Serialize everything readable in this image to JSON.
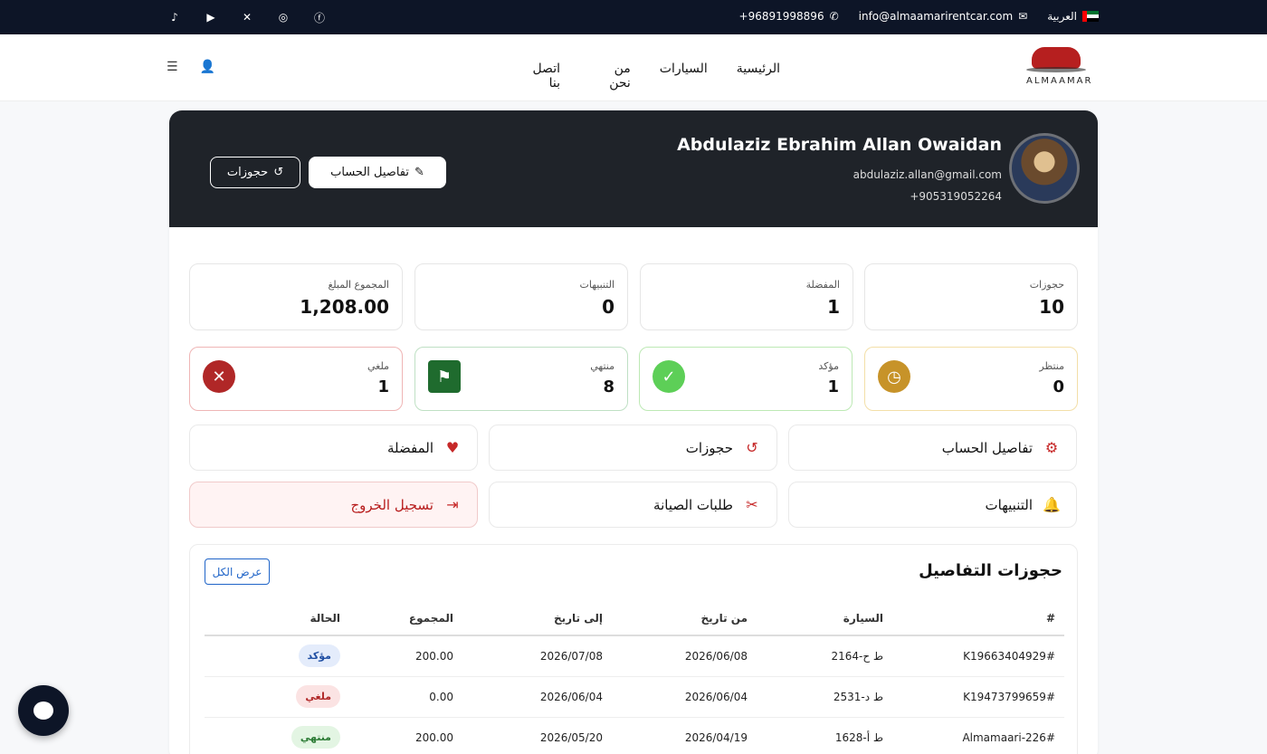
{
  "topbar": {
    "language": "العربية",
    "email": "info@almaamarirentcar.com",
    "phone": "96891998896+",
    "socials": [
      "tiktok-icon",
      "youtube-icon",
      "x-icon",
      "instagram-icon",
      "facebook-icon"
    ]
  },
  "nav": {
    "logo_text": "ALMAAMAR",
    "links": [
      "الرئيسية",
      "السيارات",
      "من نحن",
      "اتصل بنا"
    ]
  },
  "profile": {
    "name": "Abdulaziz Ebrahim Allan Owaidan",
    "email": "abdulaziz.allan@gmail.com",
    "phone": "+905319052264",
    "btn_details": "تفاصيل الحساب",
    "btn_bookings": "حجوزات"
  },
  "stats": [
    {
      "label": "حجوزات",
      "value": "10"
    },
    {
      "label": "المفضلة",
      "value": "1"
    },
    {
      "label": "التنبيهات",
      "value": "0"
    },
    {
      "label": "المجموع المبلغ",
      "value": "1,208.00"
    }
  ],
  "statuses": [
    {
      "label": "منتظر",
      "value": "0",
      "color": "#c79329",
      "border": "#f3dfa8"
    },
    {
      "label": "مؤكد",
      "value": "1",
      "color": "#5dcf57",
      "border": "#bde9b4"
    },
    {
      "label": "منتهي",
      "value": "8",
      "color": "#1f6b2e",
      "border": "#bfe0c4"
    },
    {
      "label": "ملغي",
      "value": "1",
      "color": "#b02727",
      "border": "#efb5b5"
    }
  ],
  "menu": {
    "account": "تفاصيل الحساب",
    "bookings": "حجوزات",
    "favorites": "المفضلة",
    "notifications": "التنبيهات",
    "maintenance": "طلبات الصيانة",
    "logout": "تسجيل الخروج"
  },
  "bookings": {
    "title": "حجوزات التفاصيل",
    "view_all": "عرض الكل",
    "columns": [
      "#",
      "السيارة",
      "من تاريخ",
      "إلى تاريخ",
      "المجموع",
      "الحالة"
    ],
    "rows": [
      {
        "id": "K19663404929#",
        "car": "ط ح-2164",
        "from": "2026/06/08",
        "to": "2026/07/08",
        "total": "200.00",
        "status": "مؤكد",
        "bg": "#e4ecfb",
        "fg": "#1f4ea3"
      },
      {
        "id": "K19473799659#",
        "car": "ط د-2531",
        "from": "2026/06/04",
        "to": "2026/06/04",
        "total": "0.00",
        "status": "ملغي",
        "bg": "#fbe3e3",
        "fg": "#b02727"
      },
      {
        "id": "Almamaari-226#",
        "car": "ط أ-1628",
        "from": "2026/04/19",
        "to": "2026/05/20",
        "total": "200.00",
        "status": "منتهي",
        "bg": "#e3f5e3",
        "fg": "#2b7a34"
      }
    ]
  }
}
